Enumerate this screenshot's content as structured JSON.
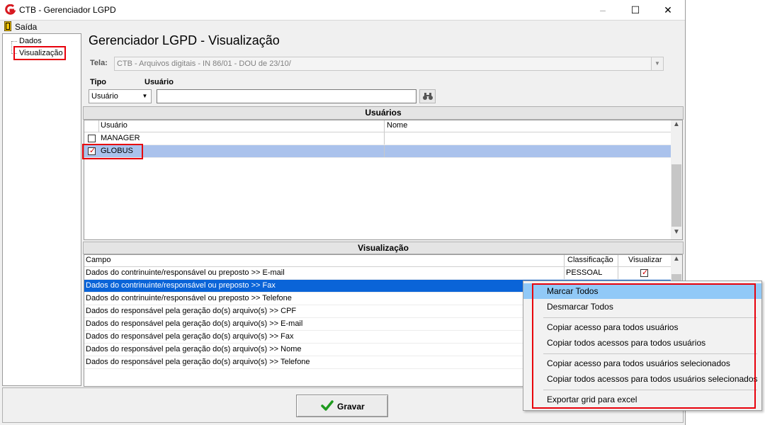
{
  "window": {
    "title": "CTB - Gerenciador LGPD",
    "min": "–",
    "max": "☐",
    "close": "✕"
  },
  "menu": {
    "saida": "Saída"
  },
  "tree": {
    "dados": "Dados",
    "visualizacao": "Visualização"
  },
  "page_title": "Gerenciador LGPD - Visualização",
  "form": {
    "tela_label": "Tela:",
    "tela_value": "CTB - Arquivos digitais - IN 86/01 - DOU de 23/10/",
    "tipo_label": "Tipo",
    "usuario_label": "Usuário",
    "tipo_value": "Usuário",
    "usuario_value": ""
  },
  "usuarios": {
    "header": "Usuários",
    "columns": [
      "Usuário",
      "Nome"
    ],
    "rows": [
      {
        "usuario": "MANAGER",
        "nome": "",
        "checked": false
      },
      {
        "usuario": "GLOBUS",
        "nome": "",
        "checked": true
      }
    ]
  },
  "visualizacao": {
    "header": "Visualização",
    "columns": [
      "Campo",
      "Classificação",
      "Visualizar"
    ],
    "rows": [
      {
        "campo": "Dados do contrinuinte/responsável ou preposto >> E-mail",
        "classificacao": "PESSOAL",
        "visualizar": true
      },
      {
        "campo": "Dados do contrinuinte/responsável ou preposto >> Fax",
        "classificacao": "",
        "visualizar": false
      },
      {
        "campo": "Dados do contrinuinte/responsável ou preposto >> Telefone",
        "classificacao": "",
        "visualizar": false
      },
      {
        "campo": "Dados do responsável pela geração do(s) arquivo(s) >> CPF",
        "classificacao": "",
        "visualizar": false
      },
      {
        "campo": "Dados do responsável pela geração do(s) arquivo(s) >> E-mail",
        "classificacao": "",
        "visualizar": false
      },
      {
        "campo": "Dados do responsável pela geração do(s) arquivo(s) >> Fax",
        "classificacao": "",
        "visualizar": false
      },
      {
        "campo": "Dados do responsável pela geração do(s) arquivo(s) >> Nome",
        "classificacao": "",
        "visualizar": false
      },
      {
        "campo": "Dados do responsável pela geração do(s) arquivo(s) >> Telefone",
        "classificacao": "",
        "visualizar": false
      }
    ]
  },
  "buttons": {
    "gravar": "Gravar"
  },
  "context_menu": {
    "items": [
      "Marcar Todos",
      "Desmarcar Todos",
      "Copiar acesso para todos usuários",
      "Copiar todos acessos para todos usuários",
      "Copiar acesso para todos usuários selecionados",
      "Copiar todos acessos para todos usuários selecionados",
      "Exportar grid para excel"
    ]
  },
  "colors": {
    "highlight_red": "#e8000b",
    "selection_blue": "#0a64d8",
    "row_light": "#aac2ec",
    "menu_hover": "#91c9f7"
  }
}
